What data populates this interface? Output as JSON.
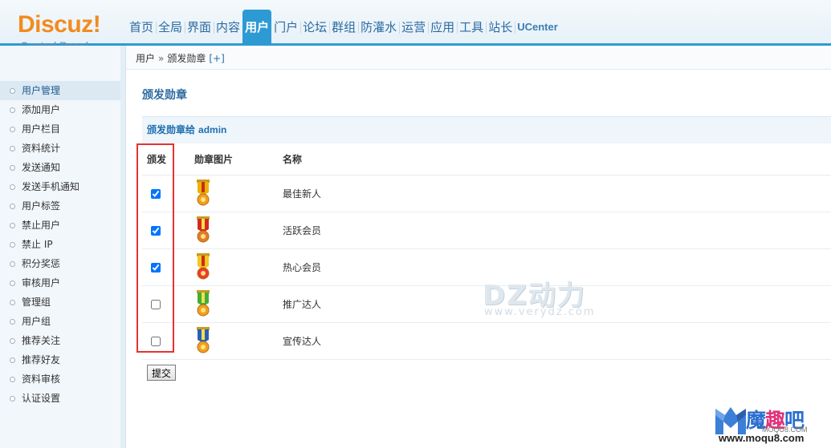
{
  "logo": {
    "title": "Discuz!",
    "subtitle": "Control Panel"
  },
  "topnav": [
    {
      "label": "首页",
      "active": false
    },
    {
      "label": "全局",
      "active": false
    },
    {
      "label": "界面",
      "active": false
    },
    {
      "label": "内容",
      "active": false
    },
    {
      "label": "用户",
      "active": true
    },
    {
      "label": "门户",
      "active": false
    },
    {
      "label": "论坛",
      "active": false
    },
    {
      "label": "群组",
      "active": false
    },
    {
      "label": "防灌水",
      "active": false
    },
    {
      "label": "运营",
      "active": false
    },
    {
      "label": "应用",
      "active": false
    },
    {
      "label": "工具",
      "active": false
    },
    {
      "label": "站长",
      "active": false
    },
    {
      "label": "UCenter",
      "active": false
    }
  ],
  "breadcrumb": {
    "parent": "用户",
    "separator": "»",
    "current": "颁发勋章",
    "add": "[+]"
  },
  "sidebar": {
    "items": [
      {
        "label": "用户管理",
        "active": true
      },
      {
        "label": "添加用户",
        "active": false
      },
      {
        "label": "用户栏目",
        "active": false
      },
      {
        "label": "资料统计",
        "active": false
      },
      {
        "label": "发送通知",
        "active": false
      },
      {
        "label": "发送手机通知",
        "active": false
      },
      {
        "label": "用户标签",
        "active": false
      },
      {
        "label": "禁止用户",
        "active": false
      },
      {
        "label": "禁止 IP",
        "active": false
      },
      {
        "label": "积分奖惩",
        "active": false
      },
      {
        "label": "审核用户",
        "active": false
      },
      {
        "label": "管理组",
        "active": false
      },
      {
        "label": "用户组",
        "active": false
      },
      {
        "label": "推荐关注",
        "active": false
      },
      {
        "label": "推荐好友",
        "active": false
      },
      {
        "label": "资料审核",
        "active": false
      },
      {
        "label": "认证设置",
        "active": false
      }
    ]
  },
  "main": {
    "title": "颁发勋章",
    "subheader_prefix": "颁发勋章给",
    "username": "admin",
    "columns": [
      "颁发",
      "勋章图片",
      "名称"
    ],
    "medals": [
      {
        "name": "最佳新人",
        "checked": true,
        "ribbon": "#e8b400",
        "stripe": "#d02a1e",
        "body": "#f0a020"
      },
      {
        "name": "活跃会员",
        "checked": true,
        "ribbon": "#d42a1e",
        "stripe": "#f4e04a",
        "body": "#e47b2a"
      },
      {
        "name": "热心会员",
        "checked": true,
        "ribbon": "#f2c81a",
        "stripe": "#d02a1e",
        "body": "#ee3a2a"
      },
      {
        "name": "推广达人",
        "checked": false,
        "ribbon": "#3fae3a",
        "stripe": "#f4e04a",
        "body": "#f0a020"
      },
      {
        "name": "宣传达人",
        "checked": false,
        "ribbon": "#2a5fb8",
        "stripe": "#f4e04a",
        "body": "#f0a020"
      }
    ],
    "submit_label": "提交"
  },
  "watermarks": {
    "dz_title": "DZ动力",
    "dz_url": "www.verydz.com",
    "moqu_title_1": "魔",
    "moqu_title_2": "趣",
    "moqu_title_3": "吧",
    "moqu_url": "www.moqu8.com",
    "moqu_small": "MOQU8.COM"
  },
  "colors": {
    "accent": "#2d9ad4",
    "highlight_box": "#e53232",
    "logo": "#f28b1e"
  }
}
